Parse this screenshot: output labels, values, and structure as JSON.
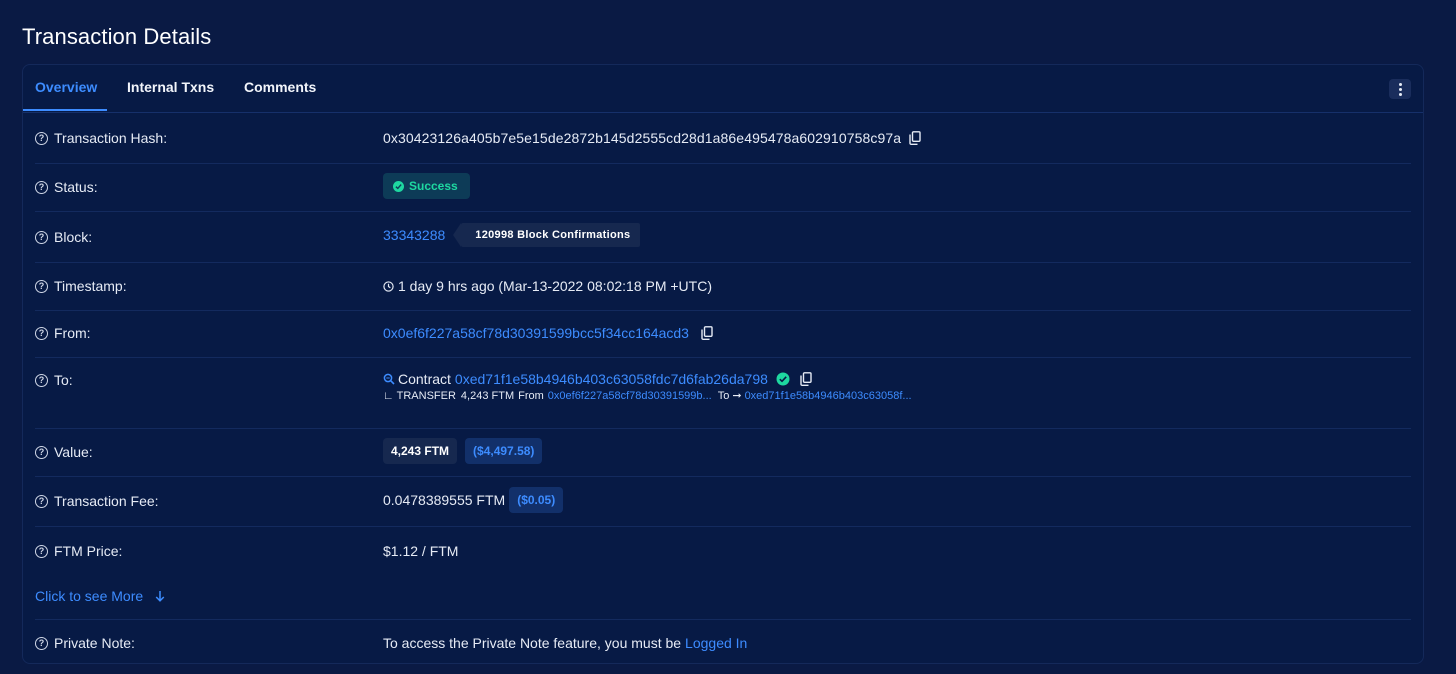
{
  "page": {
    "title": "Transaction Details"
  },
  "tabs": [
    {
      "label": "Overview"
    },
    {
      "label": "Internal Txns"
    },
    {
      "label": "Comments"
    }
  ],
  "rows": {
    "hash": {
      "label": "Transaction Hash:",
      "value": "0x30423126a405b7e5e15de2872b145d2555cd28d1a86e495478a602910758c97a"
    },
    "status": {
      "label": "Status:",
      "value": "Success"
    },
    "block": {
      "label": "Block:",
      "value": "33343288",
      "confirmations": "120998 Block Confirmations"
    },
    "timestamp": {
      "label": "Timestamp:",
      "value": "1 day 9 hrs ago (Mar-13-2022 08:02:18 PM +UTC)"
    },
    "from": {
      "label": "From:",
      "value": "0x0ef6f227a58cf78d30391599bcc5f34cc164acd3"
    },
    "to": {
      "label": "To:",
      "contract_label": "Contract",
      "value": "0xed71f1e58b4946b403c63058fdc7d6fab26da798",
      "transfer": {
        "prefix": "∟ TRANSFER",
        "amount": "4,243 FTM",
        "from_label": "From",
        "from_address": "0x0ef6f227a58cf78d30391599b...",
        "to_label": "To",
        "to_address": "0xed71f1e58b4946b403c63058f..."
      }
    },
    "value": {
      "label": "Value:",
      "amount": "4,243 FTM",
      "usd": "($4,497.58)"
    },
    "fee": {
      "label": "Transaction Fee:",
      "amount": "0.0478389555 FTM",
      "usd": "($0.05)"
    },
    "price": {
      "label": "FTM Price:",
      "value": "$1.12 / FTM"
    },
    "more": {
      "label": "Click to see More"
    },
    "note": {
      "label": "Private Note:",
      "text": "To access the Private Note feature, you must be",
      "link": "Logged In"
    }
  },
  "colors": {
    "background": "#0a1a44",
    "card": "#071a45",
    "accent": "#3d8cff",
    "success": "#1ed8a0"
  }
}
